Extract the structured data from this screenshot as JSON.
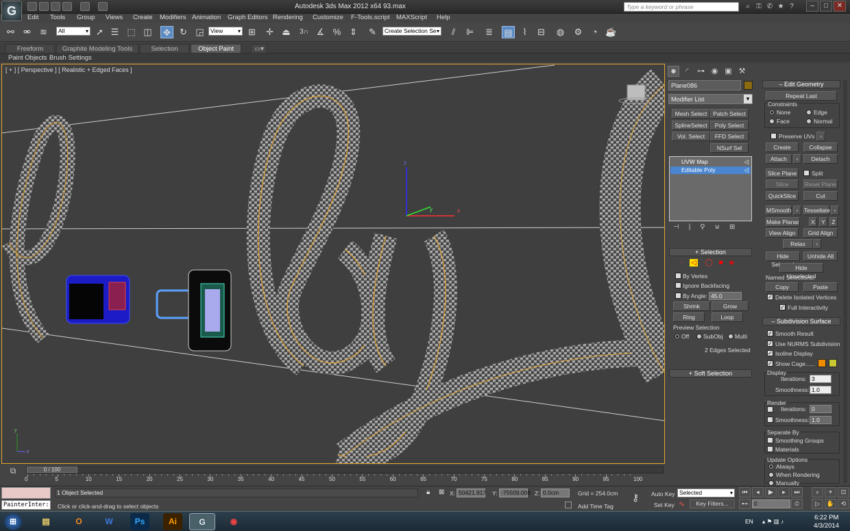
{
  "window": {
    "title": "Autodesk 3ds Max  2012 x64      93.max",
    "app_logo": "G",
    "search_placeholder": "Type a keyword or phrase"
  },
  "menubar": [
    "Edit",
    "Tools",
    "Group",
    "Views",
    "Create",
    "Modifiers",
    "Animation",
    "Graph Editors",
    "Rendering",
    "Customize",
    "F-Tools.script",
    "MAXScript",
    "Help"
  ],
  "toolbar": {
    "selection_filter": "All",
    "ref_coord": "View",
    "snap_value": "3",
    "named_selection": "Create Selection Se"
  },
  "ribbon": {
    "tabs": [
      "Freeform",
      "Graphite Modeling Tools",
      "Selection",
      "Object Paint"
    ],
    "subtabs": [
      "Paint Objects",
      "Brush Settings"
    ]
  },
  "viewport": {
    "label": "[ + ] [ Perspective ] [ Realistic + Edged Faces ]",
    "gizmo_axes": [
      "z",
      "x",
      "y"
    ],
    "corner_axes": [
      "y",
      "z"
    ]
  },
  "command_panel": {
    "object_name": "Plane086",
    "modifier_list": "Modifier List",
    "modifier_buttons": [
      "Mesh Select",
      "Patch Select",
      "SplineSelect",
      "Poly Select",
      "Vol. Select",
      "FFD Select",
      "NSurf Sel"
    ],
    "stack": [
      "UVW Map",
      "Editable Poly"
    ],
    "selection": {
      "title": "Selection",
      "by_vertex": "By Vertex",
      "ignore_backfacing": "Ignore Backfacing",
      "by_angle": "By Angle:",
      "angle_value": "45.0",
      "shrink": "Shrink",
      "grow": "Grow",
      "ring": "Ring",
      "loop": "Loop",
      "preview_label": "Preview Selection",
      "preview_options": [
        "Off",
        "SubObj",
        "Multi"
      ],
      "status": "2 Edges Selected"
    },
    "soft_selection": "Soft Selection",
    "edit_geometry": {
      "title": "Edit Geometry",
      "repeat_last": "Repeat Last",
      "constraints": "Constraints",
      "constraint_options": [
        "None",
        "Edge",
        "Face",
        "Normal"
      ],
      "preserve_uvs": "Preserve UVs",
      "create": "Create",
      "collapse": "Collapse",
      "attach": "Attach",
      "detach": "Detach",
      "slice_plane": "Slice Plane",
      "split": "Split",
      "slice": "Slice",
      "reset_plane": "Reset Plane",
      "quickslice": "QuickSlice",
      "cut": "Cut",
      "msmooth": "MSmooth",
      "tessellate": "Tessellate",
      "make_planar": "Make Planar",
      "x": "X",
      "y": "Y",
      "z": "Z",
      "view_align": "View Align",
      "grid_align": "Grid Align",
      "relax": "Relax",
      "hide_selected": "Hide Selected",
      "unhide_all": "Unhide All",
      "hide_unselected": "Hide Unselected",
      "named_selections": "Named Selections:",
      "copy": "Copy",
      "paste": "Paste",
      "delete_isolated": "Delete Isolated Vertices",
      "full_interactivity": "Full Interactivity"
    },
    "subdivision": {
      "title": "Subdivision Surface",
      "smooth_result": "Smooth Result",
      "use_nurms": "Use NURMS Subdivision",
      "isoline": "Isoline Display",
      "show_cage": "Show Cage......",
      "cage_color1": "#f08c00",
      "cage_color2": "#c8c832",
      "display": "Display",
      "iterations_label": "Iterations:",
      "iterations": "3",
      "smoothness_label": "Smoothness:",
      "smoothness": "1.0",
      "render": "Render",
      "render_iterations": "0",
      "render_smoothness": "1.0",
      "separate_by": "Separate By",
      "smoothing_groups": "Smoothing Groups",
      "materials": "Materials",
      "update_options": "Update Options",
      "update_choices": [
        "Always",
        "When Rendering",
        "Manually"
      ]
    }
  },
  "timeline": {
    "frame": "0 / 100",
    "ticks": [
      "0",
      "5",
      "10",
      "15",
      "20",
      "25",
      "30",
      "35",
      "40",
      "45",
      "50",
      "55",
      "60",
      "65",
      "70",
      "75",
      "80",
      "85",
      "90",
      "95",
      "100"
    ]
  },
  "status": {
    "selected": "1 Object Selected",
    "prompt": "Click or click-and-drag to select objects",
    "x_label": "X:",
    "x": "50421.917",
    "y_label": "Y:",
    "y": "-75509.006",
    "z_label": "Z:",
    "z": "0.0cm",
    "grid": "Grid = 254.0cm",
    "add_time_tag": "Add Time Tag",
    "auto_key": "Auto Key",
    "auto_key_mode": "Selected",
    "set_key": "Set Key",
    "key_filters": "Key Filters...",
    "current_frame": "0",
    "maxscript": "PainterInter:"
  },
  "taskbar": {
    "lang": "EN",
    "time": "6:22 PM",
    "date": "4/3/2014"
  }
}
